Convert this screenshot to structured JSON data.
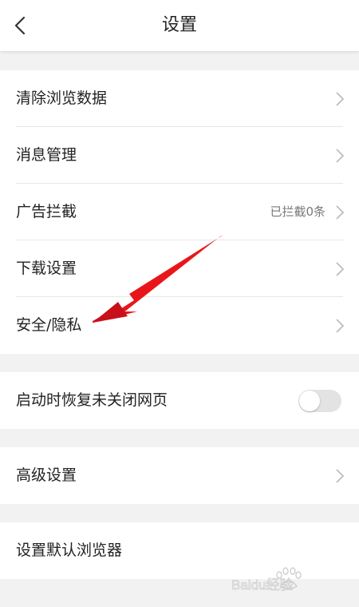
{
  "header": {
    "title": "设置",
    "back_icon": "chevron-left-icon"
  },
  "groups": [
    {
      "items": [
        {
          "label": "清除浏览数据"
        },
        {
          "label": "消息管理"
        },
        {
          "label": "广告拦截",
          "value": "已拦截0条"
        },
        {
          "label": "下载设置"
        },
        {
          "label": "安全/隐私"
        }
      ]
    },
    {
      "items": [
        {
          "label": "启动时恢复未关闭网页",
          "toggle": "off"
        }
      ]
    },
    {
      "items": [
        {
          "label": "高级设置"
        }
      ]
    },
    {
      "items": [
        {
          "label": "设置默认浏览器"
        }
      ]
    }
  ],
  "annotation": {
    "arrow_color": "#e8161b"
  },
  "watermark": {
    "text": "Baidu经验",
    "logo": "baidu-paw-logo"
  },
  "colors": {
    "background": "#f2f2f2",
    "surface": "#ffffff",
    "divider": "#e6e6e6",
    "chevron": "#bdbdbd",
    "toggle_off": "#e3e3e3"
  }
}
